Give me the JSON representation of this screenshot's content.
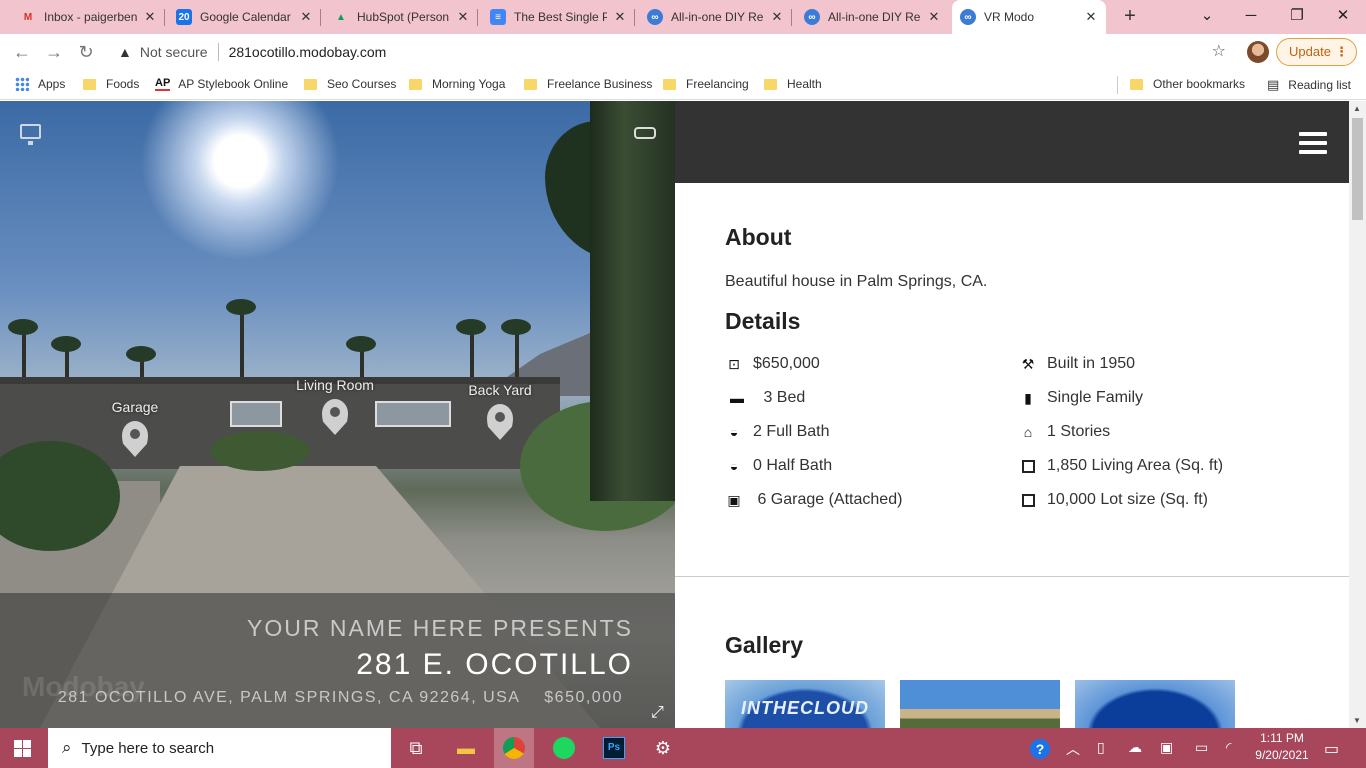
{
  "browser": {
    "tabs": [
      {
        "title": "Inbox - paigerben",
        "icon": "gmail-icon",
        "color": "#d93025",
        "glyph": "M"
      },
      {
        "title": "Google Calendar",
        "icon": "calendar-icon",
        "color": "#1a73e8",
        "glyph": "20"
      },
      {
        "title": "HubSpot (Person",
        "icon": "drive-icon",
        "color": "#0f9d58",
        "glyph": "▲"
      },
      {
        "title": "The Best Single P",
        "icon": "docs-icon",
        "color": "#4285f4",
        "glyph": "≡"
      },
      {
        "title": "All-in-one DIY Re",
        "icon": "modobay-icon",
        "color": "#3c7bd6",
        "glyph": "∞"
      },
      {
        "title": "All-in-one DIY Re",
        "icon": "modobay-icon",
        "color": "#3c7bd6",
        "glyph": "∞"
      },
      {
        "title": "VR Modo",
        "icon": "modobay-icon",
        "color": "#3c7bd6",
        "glyph": "∞"
      }
    ],
    "security_label": "Not secure",
    "url": "281ocotillo.modobay.com",
    "update_label": "Update",
    "bookmarks": [
      {
        "label": "Apps",
        "type": "apps"
      },
      {
        "label": "Foods",
        "type": "folder"
      },
      {
        "label": "AP Stylebook Online",
        "type": "ap"
      },
      {
        "label": "Seo Courses",
        "type": "folder"
      },
      {
        "label": "Morning Yoga",
        "type": "folder"
      },
      {
        "label": "Freelance Business",
        "type": "folder"
      },
      {
        "label": "Freelancing",
        "type": "folder"
      },
      {
        "label": "Health",
        "type": "folder"
      }
    ],
    "other_bookmarks": "Other bookmarks",
    "reading_list": "Reading list"
  },
  "ap_logo": "AP",
  "pano": {
    "hotspots": [
      "Garage",
      "Living Room",
      "Back Yard"
    ],
    "presents": "YOUR NAME HERE PRESENTS",
    "title": "281 E. OCOTILLO",
    "address": "281 OCOTILLO AVE, PALM SPRINGS, CA 92264, USA",
    "price": "$650,000",
    "watermark": "Modobay"
  },
  "panel": {
    "about_heading": "About",
    "about_text": "Beautiful house in Palm Springs, CA.",
    "details_heading": "Details",
    "details_left": [
      {
        "icon": "price-tag-icon",
        "glyph": "⊡",
        "text": "$650,000"
      },
      {
        "icon": "bed-icon",
        "glyph": "▬",
        "text": " 3 Bed"
      },
      {
        "icon": "bathtub-icon",
        "glyph": "◒",
        "text": "2 Full Bath"
      },
      {
        "icon": "bathtub-icon",
        "glyph": "◒",
        "text": "0 Half Bath"
      },
      {
        "icon": "car-icon",
        "glyph": "▣",
        "text": " 6 Garage (Attached)"
      }
    ],
    "details_right": [
      {
        "icon": "hammer-icon",
        "glyph": "⚒",
        "text": "Built in 1950"
      },
      {
        "icon": "book-icon",
        "glyph": "▮",
        "text": "Single Family"
      },
      {
        "icon": "home-icon",
        "glyph": "⌂",
        "text": "1 Stories"
      },
      {
        "icon": "area-icon",
        "glyph": "",
        "text": "1,850 Living Area (Sq. ft)"
      },
      {
        "icon": "area-icon",
        "glyph": "",
        "text": "10,000 Lot size (Sq. ft)"
      }
    ],
    "gallery_heading": "Gallery",
    "gallery_thumb1_text": "INTHECLOUD"
  },
  "taskbar": {
    "search_placeholder": "Type here to search",
    "time": "1:11 PM",
    "date": "9/20/2021"
  }
}
